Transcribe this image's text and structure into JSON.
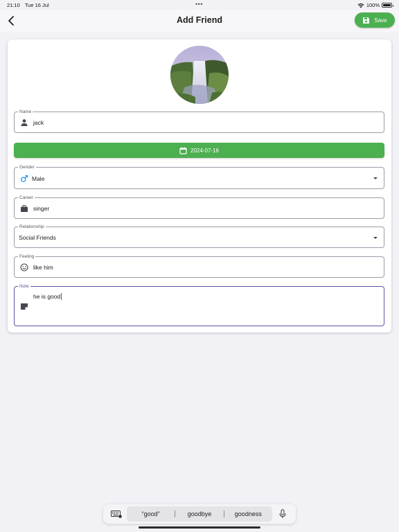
{
  "status_bar": {
    "time": "21:10",
    "date": "Tue 16 Jul",
    "dots": "•••",
    "battery": "100%"
  },
  "app_bar": {
    "title": "Add Friend",
    "save_label": "Save"
  },
  "form": {
    "name": {
      "label": "Name",
      "value": "jack",
      "icon": "person-icon"
    },
    "date_button": {
      "value": "2024-07-16",
      "icon": "calendar-icon"
    },
    "gender": {
      "label": "Gender",
      "value": "Male",
      "icon": "male-icon"
    },
    "career": {
      "label": "Career",
      "value": "singer",
      "icon": "briefcase-icon"
    },
    "relationship": {
      "label": "Relationship",
      "value": "Social Friends"
    },
    "feeling": {
      "label": "Feeling",
      "value": "like him",
      "icon": "smiley-icon"
    },
    "note": {
      "label": "Note",
      "value": "he is good",
      "icon": "note-icon"
    }
  },
  "keyboard": {
    "suggestions": [
      "“good”",
      "goodbye",
      "goodness"
    ]
  },
  "colors": {
    "accent_green": "#4caf50",
    "focus_purple": "#6750a4",
    "background": "#f2f1f6"
  }
}
